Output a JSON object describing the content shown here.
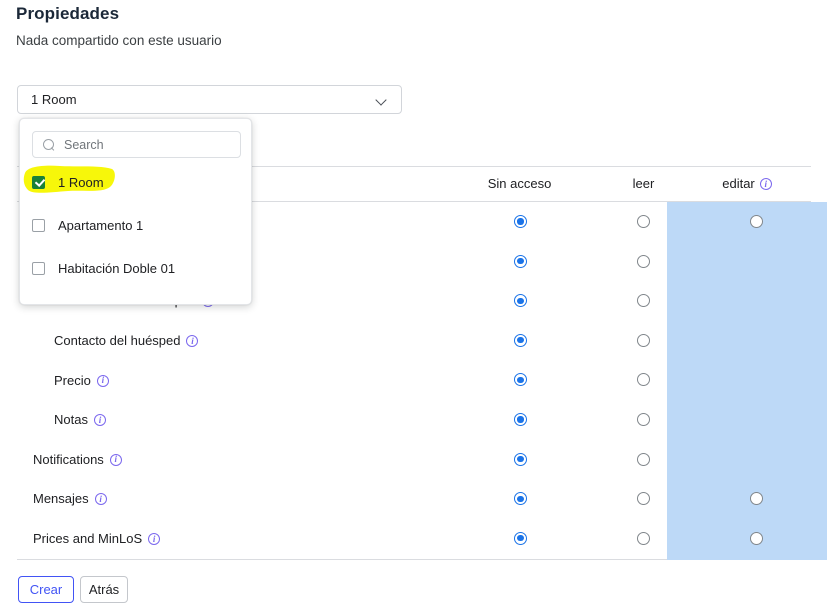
{
  "header": {
    "title": "Propiedades",
    "subtitle": "Nada compartido con este usuario"
  },
  "property_select": {
    "value": "1 Room",
    "chevron_icon": "chevron-down-icon"
  },
  "dropdown": {
    "search": {
      "placeholder": "Search",
      "value": "",
      "icon": "search-icon"
    },
    "options": [
      {
        "label": "1 Room",
        "checked": true,
        "highlighted": true
      },
      {
        "label": "Apartamento 1",
        "checked": false,
        "highlighted": false
      },
      {
        "label": "Habitación Doble 01",
        "checked": false,
        "highlighted": false
      }
    ]
  },
  "table": {
    "columns": [
      {
        "key": "no_access",
        "label": "Sin acceso",
        "info": false
      },
      {
        "key": "read",
        "label": "leer",
        "info": false
      },
      {
        "key": "edit",
        "label": "editar",
        "info": true,
        "highlighted": true
      }
    ],
    "info_icon": "info-icon",
    "rows": [
      {
        "label": "",
        "indent": 1,
        "info": false,
        "no_access": true,
        "read": false,
        "edit": true,
        "occluded": true
      },
      {
        "label": "",
        "indent": 1,
        "info": false,
        "no_access": true,
        "read": false,
        "edit": false,
        "occluded": true
      },
      {
        "label": "Información del huésped",
        "indent": 1,
        "info": true,
        "no_access": true,
        "read": false,
        "edit": false,
        "occluded": false
      },
      {
        "label": "Contacto del huésped",
        "indent": 1,
        "info": true,
        "no_access": true,
        "read": false,
        "edit": false,
        "occluded": false
      },
      {
        "label": "Precio",
        "indent": 1,
        "info": true,
        "no_access": true,
        "read": false,
        "edit": false,
        "occluded": false
      },
      {
        "label": "Notas",
        "indent": 1,
        "info": true,
        "no_access": true,
        "read": false,
        "edit": false,
        "occluded": false
      },
      {
        "label": "Notifications",
        "indent": 0,
        "info": true,
        "no_access": true,
        "read": false,
        "edit": false,
        "occluded": false
      },
      {
        "label": "Mensajes",
        "indent": 0,
        "info": true,
        "no_access": true,
        "read": false,
        "edit": true,
        "occluded": false
      },
      {
        "label": "Prices and MinLoS",
        "indent": 0,
        "info": true,
        "no_access": true,
        "read": false,
        "edit": true,
        "occluded": false
      }
    ]
  },
  "footer": {
    "create_label": "Crear",
    "back_label": "Atrás"
  },
  "colors": {
    "accent_blue": "#1a73e8",
    "create_button": "#4254f5",
    "highlight_column": "#bdd9f7",
    "checkbox_checked": "#188038",
    "marker_yellow": "#f7f70a",
    "info_icon": "#7b68ee"
  }
}
